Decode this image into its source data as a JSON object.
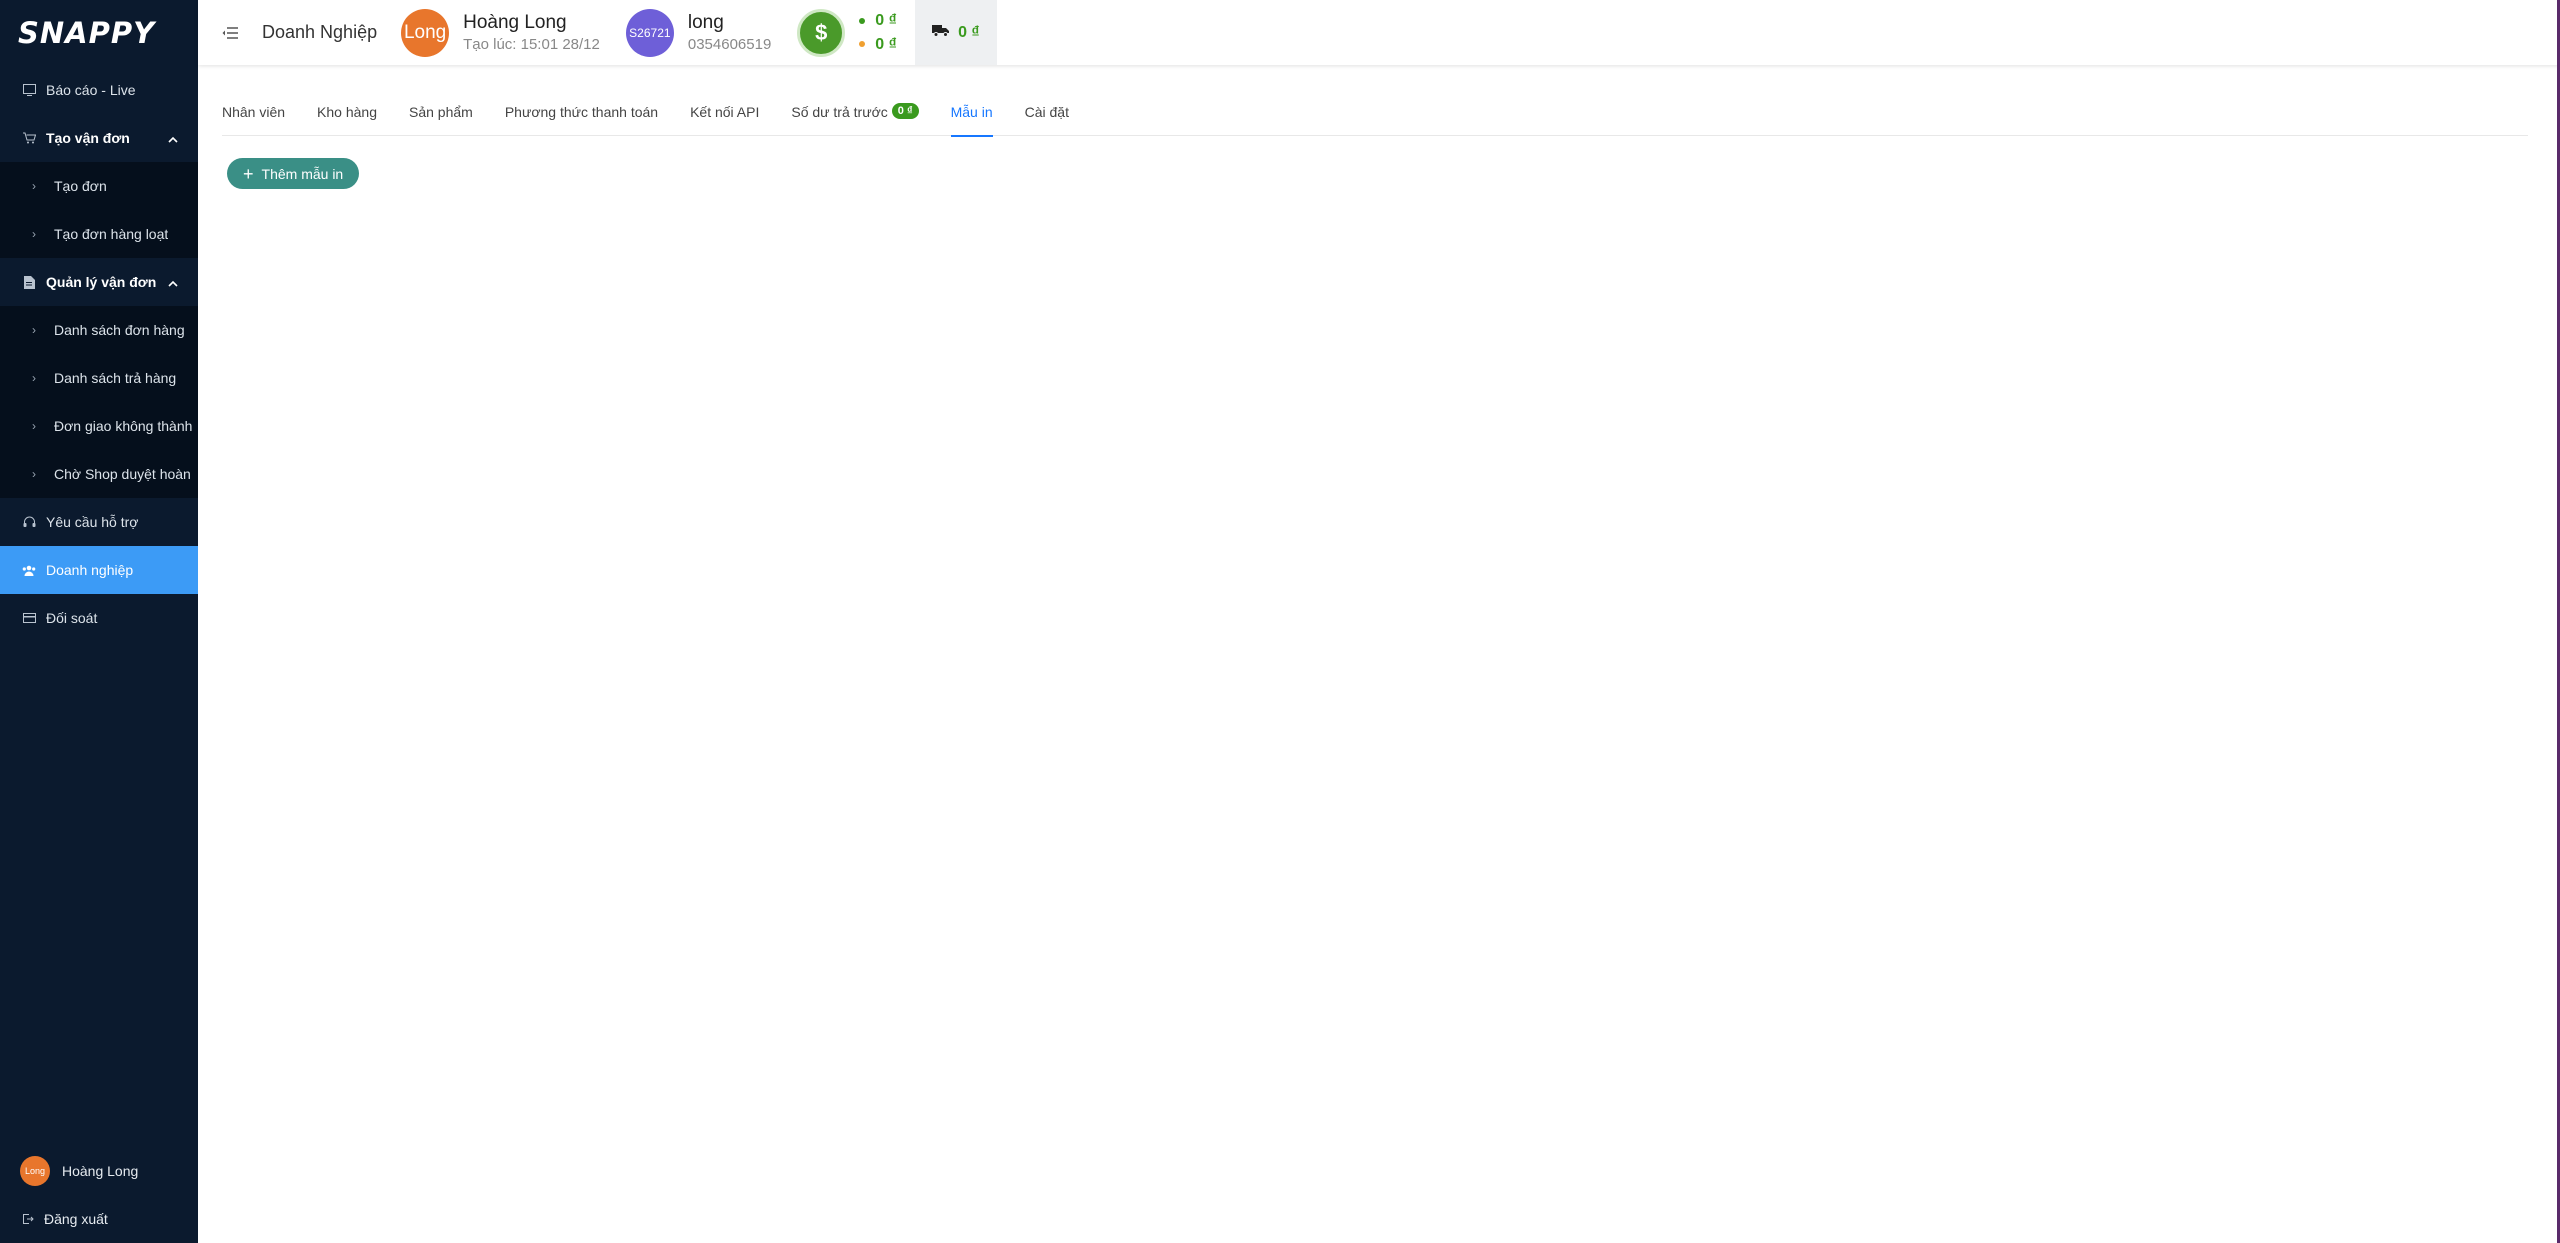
{
  "sidebar": {
    "logo": "SNAPPY",
    "items": [
      {
        "label": "Báo cáo - Live",
        "icon": "report-screen-icon"
      },
      {
        "label": "Tạo vận đơn",
        "icon": "cart-icon"
      },
      {
        "label": "Tạo đơn"
      },
      {
        "label": "Tạo đơn hàng loạt"
      },
      {
        "label": "Quản lý vận đơn",
        "icon": "document-icon"
      },
      {
        "label": "Danh sách đơn hàng"
      },
      {
        "label": "Danh sách trả hàng"
      },
      {
        "label": "Đơn giao không thành"
      },
      {
        "label": "Chờ Shop duyệt hoàn"
      },
      {
        "label": "Yêu cầu hỗ trợ",
        "icon": "headset-icon"
      },
      {
        "label": "Doanh nghiệp",
        "icon": "team-icon"
      },
      {
        "label": "Đối soát",
        "icon": "card-icon"
      }
    ],
    "user": {
      "avatar_text": "Long",
      "name": "Hoàng Long"
    },
    "logout_label": "Đăng xuất"
  },
  "header": {
    "title": "Doanh Nghiệp",
    "owner": {
      "avatar_text": "Long",
      "name": "Hoàng Long",
      "created": "Tạo lúc: 15:01 28/12"
    },
    "account": {
      "avatar_text": "S26721",
      "name": "long",
      "phone": "0354606519"
    },
    "balances": [
      {
        "value": "0 ₫",
        "dot_color": "#3a9a1e"
      },
      {
        "value": "0 ₫",
        "dot_color": "#f0a030"
      }
    ],
    "shipping_balance": "0 ₫"
  },
  "tabs": [
    {
      "label": "Nhân viên"
    },
    {
      "label": "Kho hàng"
    },
    {
      "label": "Sản phẩm"
    },
    {
      "label": "Phương thức thanh toán"
    },
    {
      "label": "Kết nối API"
    },
    {
      "label": "Số dư trả trước",
      "badge": "0 ₫"
    },
    {
      "label": "Mẫu in",
      "active": true
    },
    {
      "label": "Cài đặt"
    }
  ],
  "actions": {
    "add_template_label": "Thêm mẫu in"
  },
  "colors": {
    "sidebar_bg": "#0b1a2e",
    "active_blue": "#3c9bf6",
    "tab_blue": "#1677ff",
    "money_green": "#3a9a1e",
    "button_teal": "#3a8f86"
  }
}
